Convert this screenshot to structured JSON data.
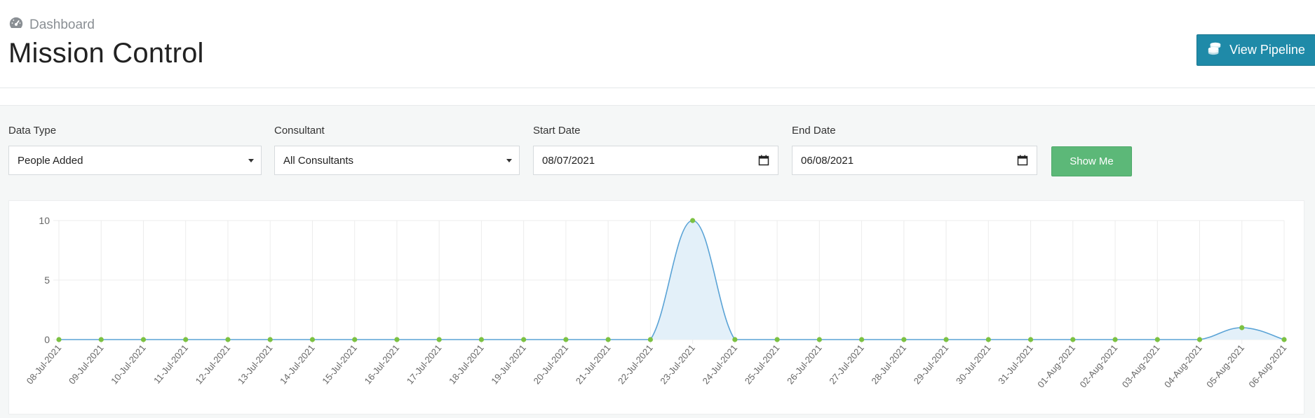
{
  "breadcrumb": {
    "icon": "dashboard-gauge-icon",
    "label": "Dashboard"
  },
  "page_title": "Mission Control",
  "header": {
    "view_pipeline_label": "View Pipeline",
    "view_pipeline_icon": "coins-icon",
    "button_color": "#1f8aa8"
  },
  "filters": {
    "data_type": {
      "label": "Data Type",
      "value": "People Added"
    },
    "consultant": {
      "label": "Consultant",
      "value": "All Consultants"
    },
    "start_date": {
      "label": "Start Date",
      "value": "08/07/2021"
    },
    "end_date": {
      "label": "End Date",
      "value": "06/08/2021"
    },
    "show_me_label": "Show Me",
    "show_me_color": "#5cb878"
  },
  "chart_data": {
    "type": "area",
    "categories": [
      "08-Jul-2021",
      "09-Jul-2021",
      "10-Jul-2021",
      "11-Jul-2021",
      "12-Jul-2021",
      "13-Jul-2021",
      "14-Jul-2021",
      "15-Jul-2021",
      "16-Jul-2021",
      "17-Jul-2021",
      "18-Jul-2021",
      "19-Jul-2021",
      "20-Jul-2021",
      "21-Jul-2021",
      "22-Jul-2021",
      "23-Jul-2021",
      "24-Jul-2021",
      "25-Jul-2021",
      "26-Jul-2021",
      "27-Jul-2021",
      "28-Jul-2021",
      "29-Jul-2021",
      "30-Jul-2021",
      "31-Jul-2021",
      "01-Aug-2021",
      "02-Aug-2021",
      "03-Aug-2021",
      "04-Aug-2021",
      "05-Aug-2021",
      "06-Aug-2021"
    ],
    "values": [
      0,
      0,
      0,
      0,
      0,
      0,
      0,
      0,
      0,
      0,
      0,
      0,
      0,
      0,
      0,
      10,
      0,
      0,
      0,
      0,
      0,
      0,
      0,
      0,
      0,
      0,
      0,
      0,
      1,
      0
    ],
    "y_ticks": [
      "0",
      "5",
      "10"
    ],
    "ylim": [
      0,
      10
    ],
    "grid": true,
    "line_color": "#5aa3d6",
    "fill_color": "#e3f0f9",
    "point_color": "#7cc142"
  }
}
